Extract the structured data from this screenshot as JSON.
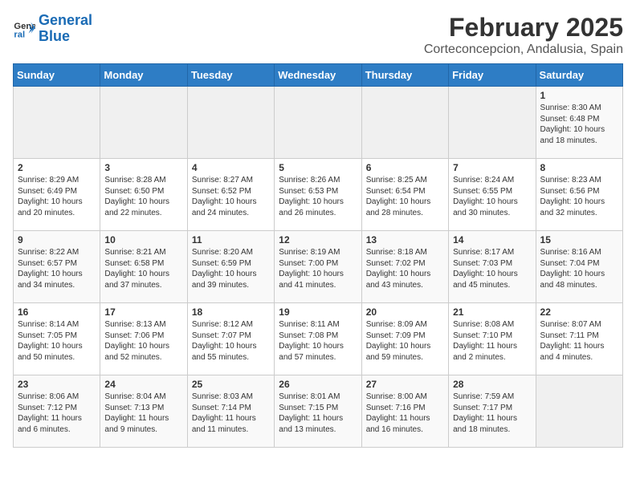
{
  "logo": {
    "line1": "General",
    "line2": "Blue"
  },
  "title": "February 2025",
  "location": "Corteconcepcion, Andalusia, Spain",
  "weekdays": [
    "Sunday",
    "Monday",
    "Tuesday",
    "Wednesday",
    "Thursday",
    "Friday",
    "Saturday"
  ],
  "weeks": [
    [
      {
        "day": "",
        "info": ""
      },
      {
        "day": "",
        "info": ""
      },
      {
        "day": "",
        "info": ""
      },
      {
        "day": "",
        "info": ""
      },
      {
        "day": "",
        "info": ""
      },
      {
        "day": "",
        "info": ""
      },
      {
        "day": "1",
        "info": "Sunrise: 8:30 AM\nSunset: 6:48 PM\nDaylight: 10 hours\nand 18 minutes."
      }
    ],
    [
      {
        "day": "2",
        "info": "Sunrise: 8:29 AM\nSunset: 6:49 PM\nDaylight: 10 hours\nand 20 minutes."
      },
      {
        "day": "3",
        "info": "Sunrise: 8:28 AM\nSunset: 6:50 PM\nDaylight: 10 hours\nand 22 minutes."
      },
      {
        "day": "4",
        "info": "Sunrise: 8:27 AM\nSunset: 6:52 PM\nDaylight: 10 hours\nand 24 minutes."
      },
      {
        "day": "5",
        "info": "Sunrise: 8:26 AM\nSunset: 6:53 PM\nDaylight: 10 hours\nand 26 minutes."
      },
      {
        "day": "6",
        "info": "Sunrise: 8:25 AM\nSunset: 6:54 PM\nDaylight: 10 hours\nand 28 minutes."
      },
      {
        "day": "7",
        "info": "Sunrise: 8:24 AM\nSunset: 6:55 PM\nDaylight: 10 hours\nand 30 minutes."
      },
      {
        "day": "8",
        "info": "Sunrise: 8:23 AM\nSunset: 6:56 PM\nDaylight: 10 hours\nand 32 minutes."
      }
    ],
    [
      {
        "day": "9",
        "info": "Sunrise: 8:22 AM\nSunset: 6:57 PM\nDaylight: 10 hours\nand 34 minutes."
      },
      {
        "day": "10",
        "info": "Sunrise: 8:21 AM\nSunset: 6:58 PM\nDaylight: 10 hours\nand 37 minutes."
      },
      {
        "day": "11",
        "info": "Sunrise: 8:20 AM\nSunset: 6:59 PM\nDaylight: 10 hours\nand 39 minutes."
      },
      {
        "day": "12",
        "info": "Sunrise: 8:19 AM\nSunset: 7:00 PM\nDaylight: 10 hours\nand 41 minutes."
      },
      {
        "day": "13",
        "info": "Sunrise: 8:18 AM\nSunset: 7:02 PM\nDaylight: 10 hours\nand 43 minutes."
      },
      {
        "day": "14",
        "info": "Sunrise: 8:17 AM\nSunset: 7:03 PM\nDaylight: 10 hours\nand 45 minutes."
      },
      {
        "day": "15",
        "info": "Sunrise: 8:16 AM\nSunset: 7:04 PM\nDaylight: 10 hours\nand 48 minutes."
      }
    ],
    [
      {
        "day": "16",
        "info": "Sunrise: 8:14 AM\nSunset: 7:05 PM\nDaylight: 10 hours\nand 50 minutes."
      },
      {
        "day": "17",
        "info": "Sunrise: 8:13 AM\nSunset: 7:06 PM\nDaylight: 10 hours\nand 52 minutes."
      },
      {
        "day": "18",
        "info": "Sunrise: 8:12 AM\nSunset: 7:07 PM\nDaylight: 10 hours\nand 55 minutes."
      },
      {
        "day": "19",
        "info": "Sunrise: 8:11 AM\nSunset: 7:08 PM\nDaylight: 10 hours\nand 57 minutes."
      },
      {
        "day": "20",
        "info": "Sunrise: 8:09 AM\nSunset: 7:09 PM\nDaylight: 10 hours\nand 59 minutes."
      },
      {
        "day": "21",
        "info": "Sunrise: 8:08 AM\nSunset: 7:10 PM\nDaylight: 11 hours\nand 2 minutes."
      },
      {
        "day": "22",
        "info": "Sunrise: 8:07 AM\nSunset: 7:11 PM\nDaylight: 11 hours\nand 4 minutes."
      }
    ],
    [
      {
        "day": "23",
        "info": "Sunrise: 8:06 AM\nSunset: 7:12 PM\nDaylight: 11 hours\nand 6 minutes."
      },
      {
        "day": "24",
        "info": "Sunrise: 8:04 AM\nSunset: 7:13 PM\nDaylight: 11 hours\nand 9 minutes."
      },
      {
        "day": "25",
        "info": "Sunrise: 8:03 AM\nSunset: 7:14 PM\nDaylight: 11 hours\nand 11 minutes."
      },
      {
        "day": "26",
        "info": "Sunrise: 8:01 AM\nSunset: 7:15 PM\nDaylight: 11 hours\nand 13 minutes."
      },
      {
        "day": "27",
        "info": "Sunrise: 8:00 AM\nSunset: 7:16 PM\nDaylight: 11 hours\nand 16 minutes."
      },
      {
        "day": "28",
        "info": "Sunrise: 7:59 AM\nSunset: 7:17 PM\nDaylight: 11 hours\nand 18 minutes."
      },
      {
        "day": "",
        "info": ""
      }
    ]
  ]
}
